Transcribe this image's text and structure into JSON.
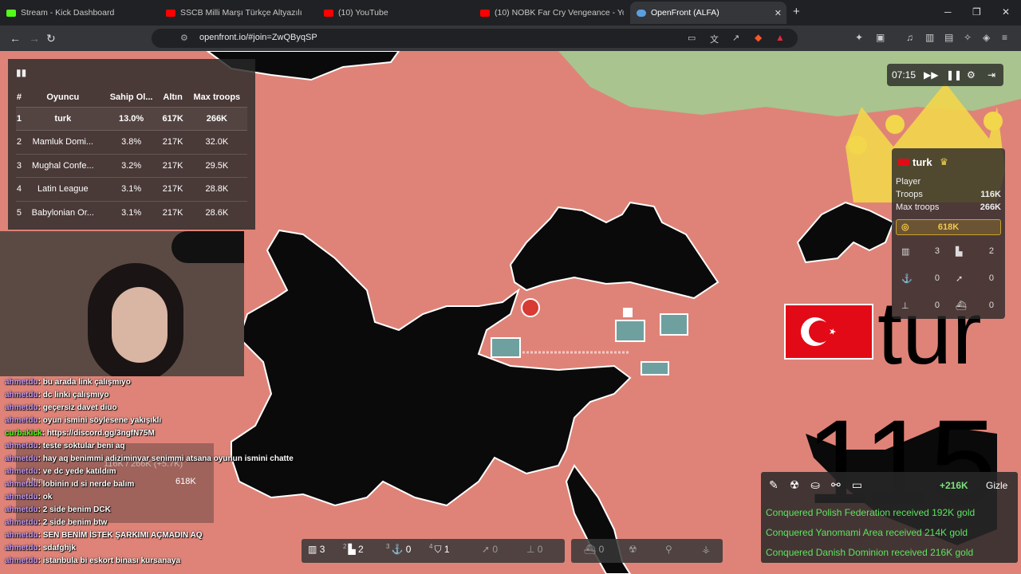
{
  "browser": {
    "tabs": [
      {
        "title": "Stream - Kick Dashboard",
        "color": "#53fc18"
      },
      {
        "title": "SSCB Milli Marşı Türkçe Altyazılı",
        "color": "#ff0000"
      },
      {
        "title": "(10) YouTube",
        "color": "#ff0000"
      },
      {
        "title": "(10) NOBK Far Cry Vengeance - YouT",
        "color": "#ff0000"
      },
      {
        "title": "OpenFront (ALFA)",
        "color": "#5aa0e0"
      }
    ],
    "url": "openfront.io/#join=ZwQByqSP"
  },
  "leaderboard": {
    "headers": [
      "#",
      "Oyuncu",
      "Sahip Ol...",
      "Altın",
      "Max troops"
    ],
    "rows": [
      {
        "rank": "1",
        "name": "turk",
        "owned": "13.0%",
        "gold": "617K",
        "max": "266K"
      },
      {
        "rank": "2",
        "name": "Mamluk Domi...",
        "owned": "3.8%",
        "gold": "217K",
        "max": "32.0K"
      },
      {
        "rank": "3",
        "name": "Mughal Confe...",
        "owned": "3.2%",
        "gold": "217K",
        "max": "29.5K"
      },
      {
        "rank": "4",
        "name": "Latin League",
        "owned": "3.1%",
        "gold": "217K",
        "max": "28.8K"
      },
      {
        "rank": "5",
        "name": "Babylonian Or...",
        "owned": "3.1%",
        "gold": "217K",
        "max": "28.6K"
      }
    ]
  },
  "game_controls": {
    "time": "07:15"
  },
  "player_card": {
    "name": "turk",
    "type": "Player",
    "troops_label": "Troops",
    "troops": "116K",
    "max_troops_label": "Max troops",
    "max_troops": "266K",
    "gold": "618K",
    "buildings": [
      {
        "icon": "city-icon",
        "count": "3"
      },
      {
        "icon": "factory-icon",
        "count": "2"
      },
      {
        "icon": "port-icon",
        "count": "0"
      },
      {
        "icon": "missile-silo-icon",
        "count": "0"
      },
      {
        "icon": "sam-launcher-icon",
        "count": "0"
      },
      {
        "icon": "warship-icon",
        "count": "0"
      }
    ]
  },
  "map": {
    "territory_label": "tur",
    "troop_label": "115"
  },
  "bottom_bar": [
    {
      "key": "",
      "icon": "city-icon",
      "count": "3"
    },
    {
      "key": "2",
      "icon": "factory-icon",
      "count": "2"
    },
    {
      "key": "3",
      "icon": "port-icon",
      "count": "0"
    },
    {
      "key": "4",
      "icon": "defense-post-icon",
      "count": "1"
    },
    {
      "key": "",
      "icon": "missile-silo-icon",
      "count": "0"
    },
    {
      "key": "",
      "icon": "sam-icon",
      "count": "0"
    }
  ],
  "bottom_bar2": [
    {
      "icon": "warship-icon",
      "count": "0"
    },
    {
      "icon": "nuke-icon",
      "count": ""
    },
    {
      "icon": "mirv-icon",
      "count": ""
    },
    {
      "icon": "hydrogen-icon",
      "count": ""
    }
  ],
  "events": {
    "gold_delta": "+216K",
    "hide_label": "Gizle",
    "messages": [
      "Conquered Polish Federation received 192K gold",
      "Conquered Yanomami Area received 214K gold",
      "Conquered Danish Dominion received 216K gold"
    ]
  },
  "overlay_popup": {
    "troops": "116K / 266K (+5.7K)",
    "gold_label": "Altın",
    "gold": "618K"
  },
  "chat": [
    {
      "user": "ahmetdu",
      "text": "bu arada link çalışmıyo"
    },
    {
      "user": "ahmetdu",
      "text": "dc linki çalışmıyo"
    },
    {
      "user": "ahmetdu",
      "text": "geçersiz davet diuo"
    },
    {
      "user": "ahmetdu",
      "text": "oyun ismini söylesene yakışıklı"
    },
    {
      "user": "curbakick",
      "text": "https://discord.gg/3ngfN75M"
    },
    {
      "user": "ahmetdu",
      "text": "teste soktular beni aq"
    },
    {
      "user": "ahmetdu",
      "text": "hay aq benimmi adiziminvar senimmi atsana oyunun ismini chatte"
    },
    {
      "user": "ahmetdu",
      "text": "ve dc yede katıldım"
    },
    {
      "user": "ahmetdu",
      "text": "lobinin ıd si nerde balım"
    },
    {
      "user": "ahmetdu",
      "text": "ok"
    },
    {
      "user": "ahmetdu",
      "text": "2 side benim DCK"
    },
    {
      "user": "ahmetdu",
      "text": "2 side benim btw"
    },
    {
      "user": "ahmetdu",
      "text": "SEN BENİM İSTEK ŞARKIMI AÇMADIN AQ"
    },
    {
      "user": "ahmetdu",
      "text": "sdafghjk"
    },
    {
      "user": "ahmetdu",
      "text": "istanbula bi eskort binası kursanaya"
    }
  ]
}
